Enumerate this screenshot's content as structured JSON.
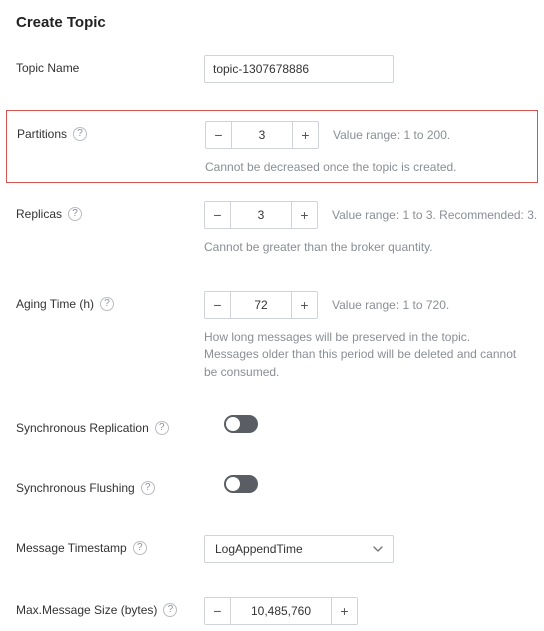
{
  "title": "Create Topic",
  "topicName": {
    "label": "Topic Name",
    "value": "topic-1307678886"
  },
  "partitions": {
    "label": "Partitions",
    "value": "3",
    "hintInline": "Value range: 1 to 200.",
    "hintBelow": "Cannot be decreased once the topic is created."
  },
  "replicas": {
    "label": "Replicas",
    "value": "3",
    "hintInline": "Value range: 1 to 3.   Recommended: 3.",
    "hintBelow": "Cannot be greater than the broker quantity."
  },
  "agingTime": {
    "label": "Aging Time (h)",
    "value": "72",
    "hintInline": "Value range: 1 to 720.",
    "hintBelow": "How long messages will be preserved in the topic. Messages older than this period will be deleted and cannot be consumed."
  },
  "syncReplication": {
    "label": "Synchronous Replication"
  },
  "syncFlushing": {
    "label": "Synchronous Flushing"
  },
  "messageTimestamp": {
    "label": "Message Timestamp",
    "value": "LogAppendTime"
  },
  "maxMessageSize": {
    "label": "Max.Message Size (bytes)",
    "value": "10,485,760"
  },
  "glyphs": {
    "minus": "−",
    "plus": "+",
    "question": "?"
  }
}
